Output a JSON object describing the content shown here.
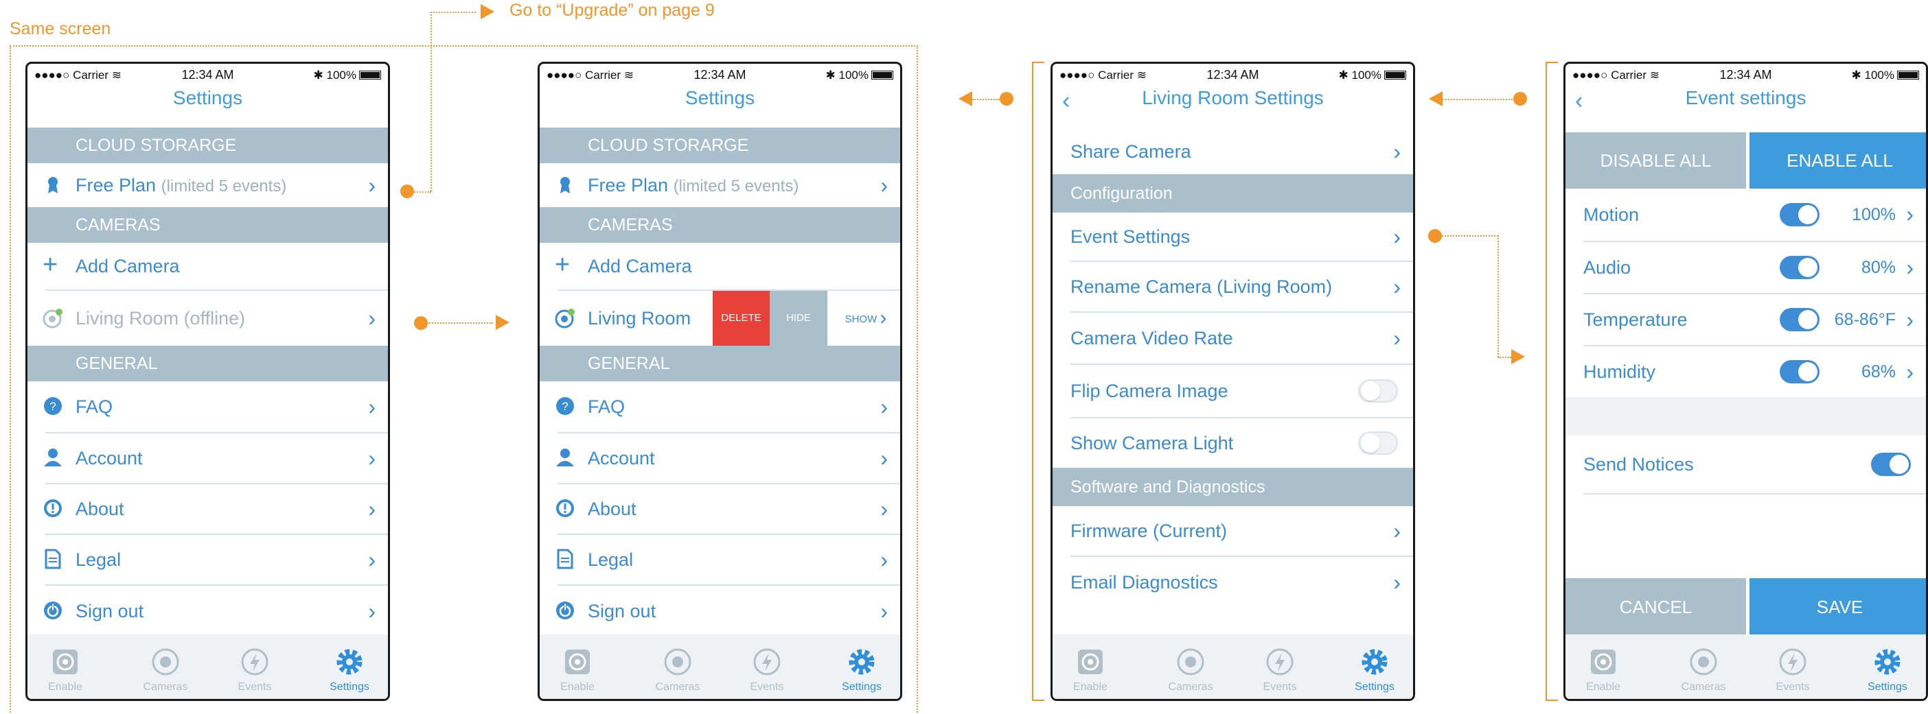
{
  "annotations": {
    "same_screen": "Same screen",
    "goto_upgrade": "Go to “Upgrade” on page 9"
  },
  "status": {
    "carrier": "●●●●○ Carrier",
    "time": "12:34 AM",
    "battery": "100%"
  },
  "settings": {
    "title": "Settings",
    "cloud_header": "CLOUD STORARGE",
    "free_plan": "Free Plan",
    "free_plan_sub": "(limited 5 events)",
    "cameras_header": "CAMERAS",
    "add_camera": "Add Camera",
    "living_room_offline": "Living Room (offline)",
    "living_room": "Living Room",
    "general_header": "GENERAL",
    "faq": "FAQ",
    "account": "Account",
    "about": "About",
    "legal": "Legal",
    "sign_out": "Sign out",
    "swipe": {
      "delete": "DELETE",
      "hide": "HIDE",
      "show": "SHOW"
    }
  },
  "living_room_settings": {
    "title": "Living Room Settings",
    "share_camera": "Share Camera",
    "config_header": "Configuration",
    "event_settings": "Event Settings",
    "rename_camera": "Rename Camera (Living Room)",
    "video_rate": "Camera Video Rate",
    "flip_image": "Flip Camera Image",
    "show_light": "Show Camera Light",
    "software_header": "Software and Diagnostics",
    "firmware": "Firmware (Current)",
    "email_diag": "Email Diagnostics"
  },
  "event_settings": {
    "title": "Event settings",
    "disable_all": "DISABLE ALL",
    "enable_all": "ENABLE ALL",
    "motion": "Motion",
    "motion_val": "100%",
    "audio": "Audio",
    "audio_val": "80%",
    "temperature": "Temperature",
    "temperature_val": "68-86°F",
    "humidity": "Humidity",
    "humidity_val": "68%",
    "send_notices": "Send Notices",
    "cancel": "CANCEL",
    "save": "SAVE"
  },
  "tabs": {
    "enable": "Enable",
    "cameras": "Cameras",
    "events": "Events",
    "settings": "Settings"
  },
  "colors": {
    "accent": "#3a8cd0",
    "section": "#a9bfcb",
    "delete": "#e8413a",
    "annotation": "#f0962a"
  }
}
